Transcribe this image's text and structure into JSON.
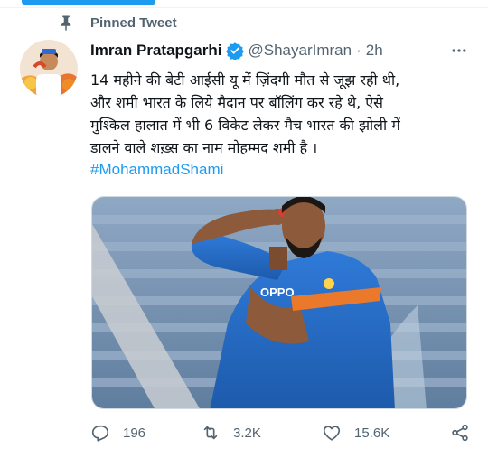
{
  "pinned_label": "Pinned Tweet",
  "author": {
    "name": "Imran Pratapgarhi",
    "handle": "@ShayarImran",
    "separator": "·",
    "time": "2h"
  },
  "tweet": {
    "lines": [
      "14 महीने की बेटी आईसी यू में ज़िंदगी मौत से जूझ रही थी,",
      "और शमी भारत के लिये मैदान पर बॉलिंग कर रहे थे, ऐसे",
      "मुश्किल हालात में भी 6 विकेट लेकर मैच भारत की झोली में",
      "डालने वाले शख़्स का नाम मोहम्मद शमी है ।"
    ],
    "hashtag": "#MohammadShami"
  },
  "media": {
    "jersey_text": "OPPO"
  },
  "actions": {
    "replies": "196",
    "retweets": "3.2K",
    "likes": "15.6K"
  },
  "colors": {
    "accent": "#1d9bf0",
    "muted": "#536471",
    "text": "#0f1419"
  }
}
